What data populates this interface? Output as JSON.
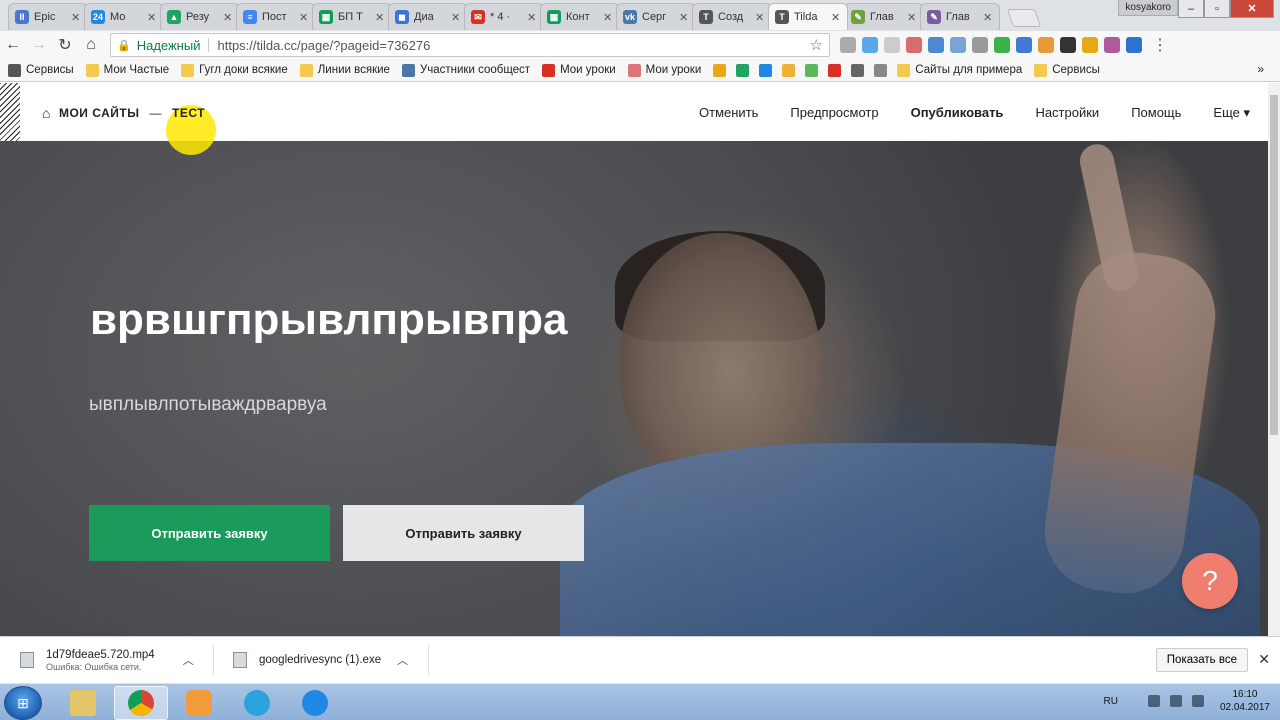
{
  "browser": {
    "tabs": [
      {
        "title": "Epic",
        "color": "#4a77c9",
        "glyph": "II"
      },
      {
        "title": "Мо",
        "color": "#1f88e5",
        "glyph": "24"
      },
      {
        "title": "Резу",
        "color": "#1fa463",
        "glyph": "▲"
      },
      {
        "title": "Пост",
        "color": "#4285f4",
        "glyph": "≡"
      },
      {
        "title": "БП Т",
        "color": "#0f9d58",
        "glyph": "▦"
      },
      {
        "title": "Диа",
        "color": "#3b73d9",
        "glyph": "◼"
      },
      {
        "title": "* 4 ·",
        "color": "#d93025",
        "glyph": "✉"
      },
      {
        "title": "Конт",
        "color": "#0f9d58",
        "glyph": "▦"
      },
      {
        "title": "Серг",
        "color": "#4a76a8",
        "glyph": "vk"
      },
      {
        "title": "Созд",
        "color": "#555555",
        "glyph": "T"
      },
      {
        "title": "Tilda",
        "color": "#555555",
        "glyph": "T",
        "active": true
      },
      {
        "title": "Глав",
        "color": "#6ca33a",
        "glyph": "✎"
      },
      {
        "title": "Глав",
        "color": "#7a5c9c",
        "glyph": "✎"
      }
    ],
    "profile": "kosyakoro",
    "security_label": "Надежный",
    "url": "https://tilda.cc/page/?pageid=736276",
    "bookmarks": [
      {
        "label": "Сервисы",
        "type": "apps"
      },
      {
        "label": "Мои Частые",
        "type": "folder"
      },
      {
        "label": "Гугл доки всякие",
        "type": "folder"
      },
      {
        "label": "Линии всякие",
        "type": "folder"
      },
      {
        "label": "Участники сообщест",
        "type": "vk"
      },
      {
        "label": "Мои уроки",
        "type": "star"
      },
      {
        "label": "Мои уроки",
        "type": "swirl"
      },
      {
        "label": "",
        "type": "icons"
      },
      {
        "label": "Сайты для примера",
        "type": "folder"
      },
      {
        "label": "Сервисы",
        "type": "folder"
      }
    ]
  },
  "tilda": {
    "breadcrumb_home": "МОИ САЙТЫ",
    "breadcrumb_dash": "—",
    "breadcrumb_page": "ТЕСТ",
    "nav": {
      "cancel": "Отменить",
      "preview": "Предпросмотр",
      "publish": "Опубликовать",
      "settings": "Настройки",
      "help": "Помощь",
      "more": "Еще ▾"
    },
    "hero": {
      "title": "врвшгпрывлпрывпра",
      "subtitle": "ывплывлпотываждрварвуа",
      "button1": "Отправить заявку",
      "button2": "Отправить заявку"
    },
    "help_glyph": "?"
  },
  "downloads": [
    {
      "name": "1d79fdeae5.720.mp4",
      "status": "Ошибка: Ошибка сети."
    },
    {
      "name": "googledrivesync (1).exe",
      "status": ""
    }
  ],
  "downloads_show_all": "Показать все",
  "taskbar": {
    "lang": "RU",
    "time": "16:10",
    "date": "02.04.2017"
  },
  "colors": {
    "accent_green": "#1a9a5b",
    "help_button": "#f07e6e"
  }
}
